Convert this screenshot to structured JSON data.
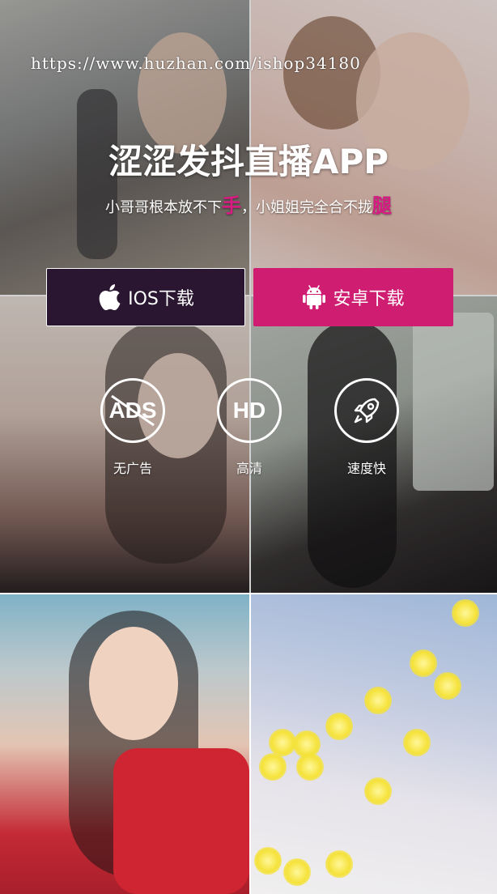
{
  "watermark": "https://www.huzhan.com/ishop34180",
  "headline": "涩涩发抖直播APP",
  "tagline": {
    "part1": "小哥哥根本放不下",
    "highlight1": "手",
    "part2": "，小姐姐完全合不拢",
    "highlight2": "腿",
    "highlight_color": "#d81b82"
  },
  "buttons": {
    "ios": {
      "label": "IOS下载",
      "icon": "apple-icon",
      "bg_color": "#2a1630"
    },
    "android": {
      "label": "安卓下载",
      "icon": "android-icon",
      "bg_color": "#cf1e72"
    }
  },
  "features": [
    {
      "label": "无广告",
      "icon": "no-ads-icon",
      "icon_text": "ADS"
    },
    {
      "label": "高清",
      "icon": "hd-icon",
      "icon_text": "HD"
    },
    {
      "label": "速度快",
      "icon": "rocket-icon"
    }
  ]
}
